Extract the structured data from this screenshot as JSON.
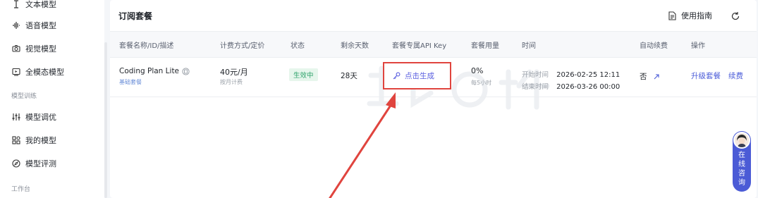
{
  "sidebar": {
    "items": [
      {
        "label": "文本模型",
        "icon": "text-cursor-icon"
      },
      {
        "label": "语音模型",
        "icon": "waveform-icon"
      },
      {
        "label": "视觉模型",
        "icon": "camera-icon"
      },
      {
        "label": "全模态模型",
        "icon": "multimodal-icon"
      }
    ],
    "group_training": "模型训练",
    "training_items": [
      {
        "label": "模型调优",
        "icon": "sliders-icon"
      },
      {
        "label": "我的模型",
        "icon": "grid-icon"
      },
      {
        "label": "模型评测",
        "icon": "compass-icon"
      }
    ],
    "group_workbench": "工作台"
  },
  "card": {
    "title": "订阅套餐",
    "help_label": "使用指南",
    "columns": [
      "套餐名称/ID/描述",
      "计费方式/定价",
      "状态",
      "剩余天数",
      "套餐专属API Key",
      "套餐用量",
      "时间",
      "自动续费",
      "操作"
    ],
    "row": {
      "plan_name": "Coding Plan Lite",
      "plan_tag": "基础套餐",
      "price": "40元/月",
      "billing": "按月计费",
      "status": "生效中",
      "days_left": "28天",
      "api_key_action": "点击生成",
      "usage": "0%",
      "usage_window": "每5小时",
      "start_label": "开始时间",
      "start_time": "2026-02-25 12:11",
      "end_label": "结束时间",
      "end_time": "2026-03-26 00:00",
      "auto_renew": "否",
      "action_upgrade": "升级套餐",
      "action_renew": "续费"
    }
  },
  "consult": {
    "label": "在线咨询"
  },
  "colors": {
    "accent": "#4a5bd8",
    "status_green": "#2fa36b",
    "highlight_red": "#e0443e"
  }
}
